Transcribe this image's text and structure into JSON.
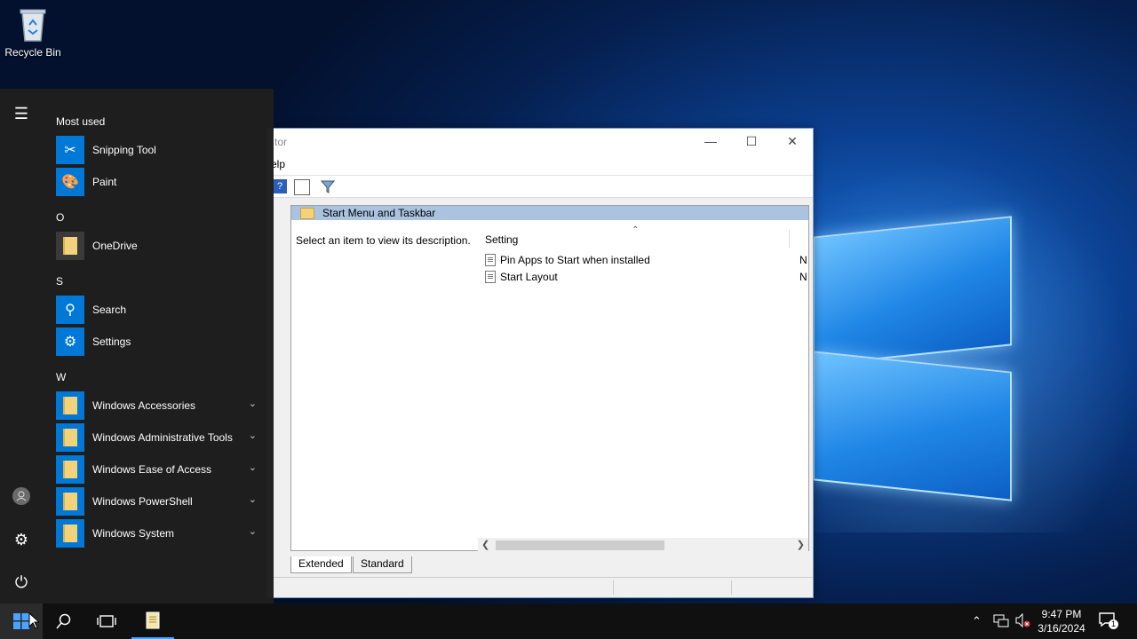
{
  "desktop": {
    "recycle_bin_label": "Recycle Bin"
  },
  "editor_window": {
    "title_partial": "tor",
    "menu_partial": "elp",
    "header_title": "Start Menu and Taskbar",
    "description": "Select an item to view its description.",
    "column_header": "Setting",
    "rows": [
      {
        "label": "Pin Apps to Start when installed",
        "state": "N"
      },
      {
        "label": "Start Layout",
        "state": "N"
      }
    ],
    "tabs": [
      "Extended",
      "Standard"
    ]
  },
  "start_menu": {
    "most_used_label": "Most used",
    "groups": [
      {
        "letter": "",
        "apps": [
          "Snipping Tool",
          "Paint"
        ]
      },
      {
        "letter": "O",
        "apps": [
          "OneDrive"
        ]
      },
      {
        "letter": "S",
        "apps": [
          "Search",
          "Settings"
        ]
      },
      {
        "letter": "W",
        "apps": [
          "Windows Accessories",
          "Windows Administrative Tools",
          "Windows Ease of Access",
          "Windows PowerShell",
          "Windows System"
        ]
      }
    ],
    "letters": {
      "o": "O",
      "s": "S",
      "w": "W"
    },
    "apps": {
      "snipping_tool": "Snipping Tool",
      "paint": "Paint",
      "onedrive": "OneDrive",
      "search": "Search",
      "settings": "Settings",
      "win_accessories": "Windows Accessories",
      "win_admin_tools": "Windows Administrative Tools",
      "win_ease_access": "Windows Ease of Access",
      "win_powershell": "Windows PowerShell",
      "win_system": "Windows System"
    }
  },
  "taskbar": {
    "time": "9:47 PM",
    "date": "3/16/2024",
    "notification_count": "1"
  },
  "colors": {
    "accent": "#0078d7",
    "start_bg": "#1f1f1f",
    "taskbar_bg": "#101010",
    "folder": "#f2d27a"
  }
}
